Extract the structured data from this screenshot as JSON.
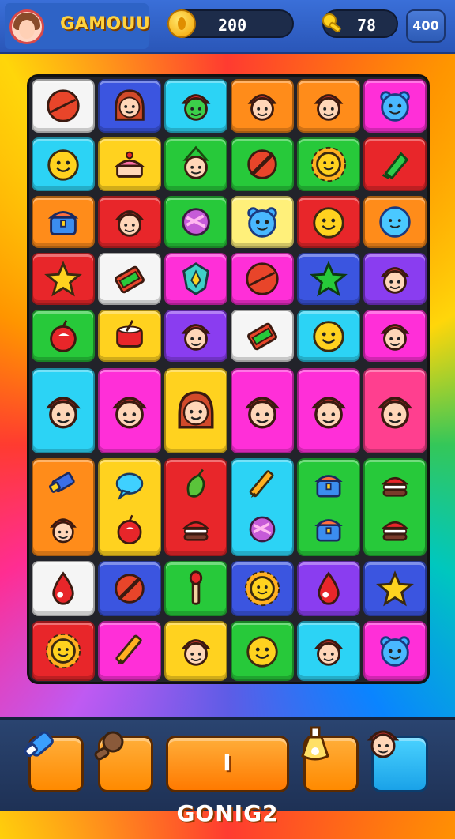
{
  "header": {
    "title": "GAMOUU",
    "coins": "200",
    "keys": "78",
    "level": "400"
  },
  "colors": {
    "red": "#e8262a",
    "orange": "#ff8c1a",
    "yellow": "#ffd21f",
    "green": "#27c93a",
    "cyan": "#2cd3f5",
    "blue": "#3b55e0",
    "purple": "#8a3df0",
    "magenta": "#ff2fd8",
    "pink": "#ff3f8f",
    "white": "#f5f5f5",
    "lightyellow": "#fff07a"
  },
  "board": {
    "tiles": [
      {
        "name": "tile-ball",
        "icon": "ball-icon",
        "bg": "white"
      },
      {
        "name": "tile-girl",
        "icon": "girl-face-icon",
        "bg": "blue"
      },
      {
        "name": "tile-green-face",
        "icon": "green-face-icon",
        "bg": "cyan"
      },
      {
        "name": "tile-face",
        "icon": "face-icon",
        "bg": "orange"
      },
      {
        "name": "tile-face",
        "icon": "face-icon",
        "bg": "orange"
      },
      {
        "name": "tile-blue-face",
        "icon": "blue-face-icon",
        "bg": "magenta"
      },
      {
        "name": "tile-smiley",
        "icon": "smiley-icon",
        "bg": "cyan"
      },
      {
        "name": "tile-cake",
        "icon": "cake-icon",
        "bg": "yellow"
      },
      {
        "name": "tile-elf",
        "icon": "elf-face-icon",
        "bg": "green"
      },
      {
        "name": "tile-no-sign",
        "icon": "no-sign-icon",
        "bg": "green"
      },
      {
        "name": "tile-blue-sun",
        "icon": "sun-icon",
        "bg": "green"
      },
      {
        "name": "tile-gem",
        "icon": "gem-icon",
        "bg": "red"
      },
      {
        "name": "tile-chest",
        "icon": "chest-icon",
        "bg": "orange"
      },
      {
        "name": "tile-face",
        "icon": "face-icon",
        "bg": "red"
      },
      {
        "name": "tile-candy",
        "icon": "candy-icon",
        "bg": "green"
      },
      {
        "name": "tile-blue-face",
        "icon": "blue-face-icon",
        "bg": "lightyellow"
      },
      {
        "name": "tile-smiley",
        "icon": "smiley-icon",
        "bg": "red"
      },
      {
        "name": "tile-blue-ball",
        "icon": "blue-ball-icon",
        "bg": "orange"
      },
      {
        "name": "tile-star",
        "icon": "star-icon",
        "bg": "red"
      },
      {
        "name": "tile-book",
        "icon": "book-icon",
        "bg": "white"
      },
      {
        "name": "tile-shield",
        "icon": "shield-icon",
        "bg": "magenta"
      },
      {
        "name": "tile-ball",
        "icon": "ball-icon",
        "bg": "magenta"
      },
      {
        "name": "tile-star",
        "icon": "green-star-icon",
        "bg": "blue"
      },
      {
        "name": "tile-face",
        "icon": "face-icon",
        "bg": "purple"
      },
      {
        "name": "tile-apple",
        "icon": "apple-icon",
        "bg": "green"
      },
      {
        "name": "tile-drum",
        "icon": "drum-icon",
        "bg": "yellow"
      },
      {
        "name": "tile-face",
        "icon": "face-icon",
        "bg": "purple"
      },
      {
        "name": "tile-book",
        "icon": "book-icon",
        "bg": "white"
      },
      {
        "name": "tile-smiley",
        "icon": "smiley-icon",
        "bg": "cyan"
      },
      {
        "name": "tile-face",
        "icon": "face-icon",
        "bg": "magenta"
      },
      {
        "name": "tile-face",
        "icon": "face-icon",
        "bg": "cyan"
      },
      {
        "name": "tile-face",
        "icon": "face-icon",
        "bg": "magenta"
      },
      {
        "name": "tile-girl",
        "icon": "girl-face-icon",
        "bg": "yellow"
      },
      {
        "name": "tile-face",
        "icon": "face-icon",
        "bg": "magenta"
      },
      {
        "name": "tile-face",
        "icon": "face-icon",
        "bg": "magenta"
      },
      {
        "name": "tile-face",
        "icon": "face-icon",
        "bg": "pink"
      }
    ],
    "lower_tiles": [
      {
        "name": "tile-eraser-face",
        "icon": "eraser-icon",
        "bg": "orange"
      },
      {
        "name": "tile-bubble-apple",
        "icon": "bubble-icon",
        "bg": "yellow"
      },
      {
        "name": "tile-pepper-burger",
        "icon": "pepper-icon",
        "bg": "red"
      },
      {
        "name": "tile-pencil-egg",
        "icon": "pencil-icon",
        "bg": "cyan"
      },
      {
        "name": "tile-chests",
        "icon": "chest-icon",
        "bg": "green"
      },
      {
        "name": "tile-burgers",
        "icon": "burger-icon",
        "bg": "green"
      },
      {
        "name": "tile-drop",
        "icon": "drop-icon",
        "bg": "white"
      },
      {
        "name": "tile-no-sign",
        "icon": "no-sign-icon",
        "bg": "blue"
      },
      {
        "name": "tile-brush",
        "icon": "brush-icon",
        "bg": "green"
      },
      {
        "name": "tile-sun",
        "icon": "sun-icon",
        "bg": "blue"
      },
      {
        "name": "tile-drop",
        "icon": "drop-icon",
        "bg": "purple"
      },
      {
        "name": "tile-star",
        "icon": "star-icon",
        "bg": "blue"
      },
      {
        "name": "tile-sun",
        "icon": "sun-icon",
        "bg": "red"
      },
      {
        "name": "tile-pencil",
        "icon": "pencil-icon",
        "bg": "magenta"
      },
      {
        "name": "tile-face",
        "icon": "face-icon",
        "bg": "yellow"
      },
      {
        "name": "tile-smiley",
        "icon": "smiley-icon",
        "bg": "green"
      },
      {
        "name": "tile-face",
        "icon": "face-icon",
        "bg": "cyan"
      },
      {
        "name": "tile-blue-face",
        "icon": "blue-face-icon",
        "bg": "magenta"
      }
    ]
  },
  "footer": {
    "play_label": "I GONIG2",
    "buttons": [
      {
        "name": "eraser-button",
        "icon": "eraser-icon"
      },
      {
        "name": "hammer-button",
        "icon": "hammer-icon"
      },
      {
        "name": "potion-button",
        "icon": "potion-icon"
      },
      {
        "name": "character-button",
        "icon": "face-icon"
      }
    ]
  }
}
